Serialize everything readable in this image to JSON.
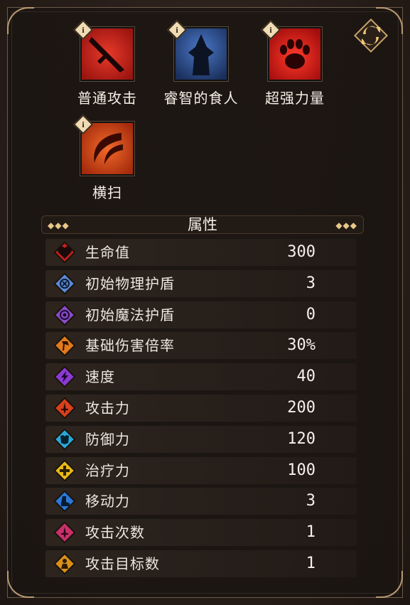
{
  "skills": [
    {
      "label": "普通攻击",
      "icon": "sword-strike-icon",
      "color": "#c8221c",
      "info": "i"
    },
    {
      "label": "睿智的食人",
      "icon": "hooded-figure-icon",
      "color": "#2a4a8a",
      "info": "i"
    },
    {
      "label": "超强力量",
      "icon": "paw-print-icon",
      "color": "#b81414",
      "info": "i"
    },
    {
      "label": "横扫",
      "icon": "sweep-slash-icon",
      "color": "#d24a18",
      "info": "i"
    }
  ],
  "attributes": {
    "title": "属性",
    "rows": [
      {
        "name": "生命值",
        "value": "300",
        "icon": "heart-icon",
        "color": "#c8201c"
      },
      {
        "name": "初始物理护盾",
        "value": "3",
        "icon": "physical-shield-icon",
        "color": "#5a8ad8"
      },
      {
        "name": "初始魔法护盾",
        "value": "0",
        "icon": "magic-shield-icon",
        "color": "#8a4ac8"
      },
      {
        "name": "基础伤害倍率",
        "value": "30%",
        "icon": "axe-icon",
        "color": "#e07a1c"
      },
      {
        "name": "速度",
        "value": "40",
        "icon": "lightning-icon",
        "color": "#8a3ad0"
      },
      {
        "name": "攻击力",
        "value": "200",
        "icon": "sword-icon",
        "color": "#d8401c"
      },
      {
        "name": "防御力",
        "value": "120",
        "icon": "armor-icon",
        "color": "#2aa8d8"
      },
      {
        "name": "治疗力",
        "value": "100",
        "icon": "cross-icon",
        "color": "#e8b818"
      },
      {
        "name": "移动力",
        "value": "3",
        "icon": "boot-icon",
        "color": "#2a78d8"
      },
      {
        "name": "攻击次数",
        "value": "1",
        "icon": "sword-count-icon",
        "color": "#c8306a"
      },
      {
        "name": "攻击目标数",
        "value": "1",
        "icon": "target-person-icon",
        "color": "#d8901c"
      }
    ]
  }
}
